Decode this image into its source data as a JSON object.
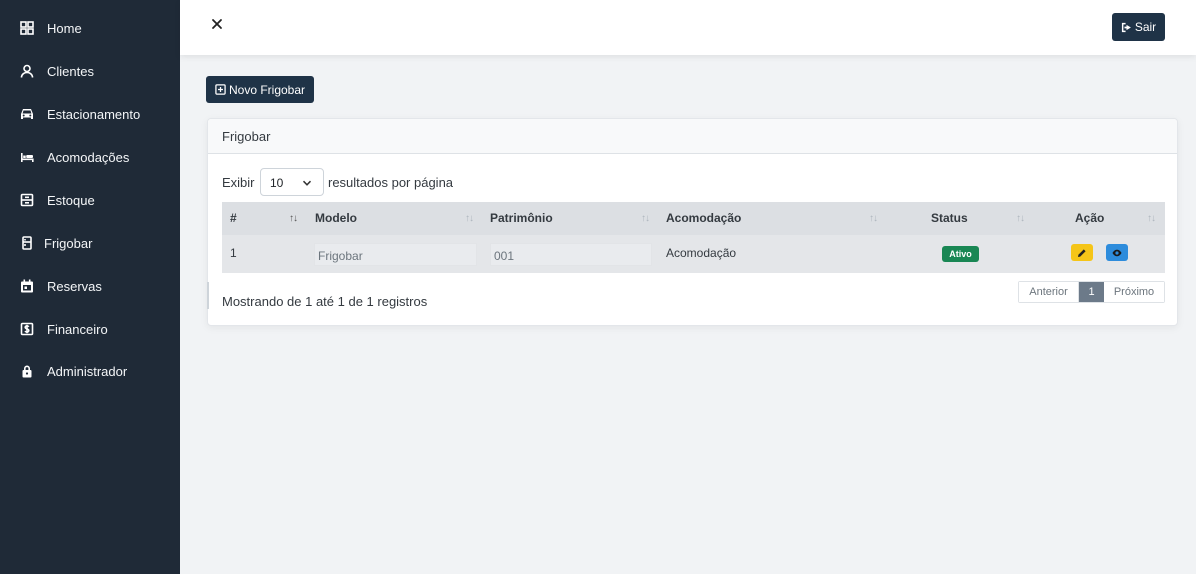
{
  "sidebar": {
    "items": [
      {
        "label": "Home",
        "icon": "grid-icon"
      },
      {
        "label": "Clientes",
        "icon": "user-icon"
      },
      {
        "label": "Estacionamento",
        "icon": "car-icon"
      },
      {
        "label": "Acomodações",
        "icon": "bed-icon"
      },
      {
        "label": "Estoque",
        "icon": "box-icon"
      },
      {
        "label": "Frigobar",
        "icon": "fridge-icon"
      },
      {
        "label": "Reservas",
        "icon": "calendar-icon"
      },
      {
        "label": "Financeiro",
        "icon": "money-icon"
      },
      {
        "label": "Administrador",
        "icon": "lock-icon"
      }
    ]
  },
  "topbar": {
    "close_icon": "close-icon",
    "logout_label": "Sair"
  },
  "toolbar": {
    "new_label": "Novo Frigobar"
  },
  "card": {
    "title": "Frigobar",
    "length": {
      "prefix": "Exibir",
      "value": "10",
      "suffix": "resultados por página"
    },
    "columns": [
      "#",
      "Modelo",
      "Patrimônio",
      "Acomodação",
      "Status",
      "Ação"
    ],
    "rows": [
      {
        "id": "1",
        "modelo": "Frigobar",
        "patrimonio": "001",
        "acomodacao": "Acomodação",
        "status": "Ativo"
      }
    ],
    "info": "Mostrando de 1 até 1 de 1 registros",
    "pagination": {
      "prev": "Anterior",
      "current": "1",
      "next": "Próximo"
    }
  },
  "colors": {
    "sidebar_bg": "#1f2a37",
    "primary_btn": "#1f3347",
    "status_active": "#198754",
    "edit_btn": "#f5c518",
    "view_btn": "#2d8cdc"
  }
}
